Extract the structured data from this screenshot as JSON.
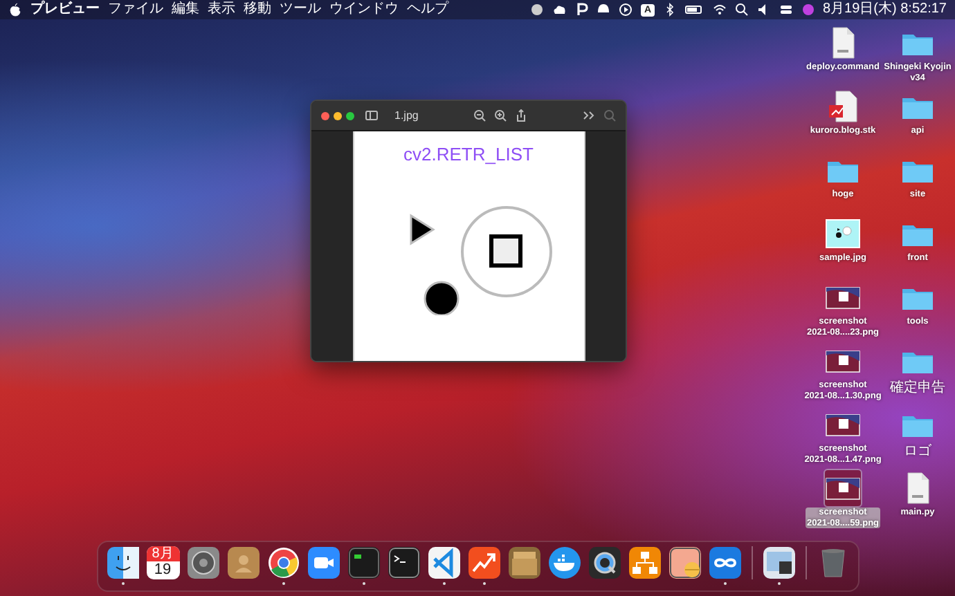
{
  "menu_bar": {
    "app_name": "プレビュー",
    "menus": [
      "ファイル",
      "編集",
      "表示",
      "移動",
      "ツール",
      "ウインドウ",
      "ヘルプ"
    ],
    "input_source": "A",
    "clock": "8月19日(木) 8:52:17"
  },
  "window": {
    "title": "1.jpg",
    "image": {
      "caption": "cv2.RETR_LIST"
    }
  },
  "desktop_icons": [
    {
      "kind": "script",
      "label_lines": [
        "deploy.command"
      ],
      "selected": false
    },
    {
      "kind": "stickies",
      "label_lines": [
        "kuroro.blog.stk"
      ],
      "selected": false
    },
    {
      "kind": "folder",
      "label_lines": [
        "hoge"
      ],
      "selected": false
    },
    {
      "kind": "image",
      "label_lines": [
        "sample.jpg"
      ],
      "selected": false
    },
    {
      "kind": "screenshot",
      "label_lines": [
        "screenshot",
        "2021-08....23.png"
      ],
      "selected": false
    },
    {
      "kind": "screenshot",
      "label_lines": [
        "screenshot",
        "2021-08...1.30.png"
      ],
      "selected": false
    },
    {
      "kind": "screenshot",
      "label_lines": [
        "screenshot",
        "2021-08...1.47.png"
      ],
      "selected": false
    },
    {
      "kind": "screenshot",
      "label_lines": [
        "screenshot",
        "2021-08....59.png"
      ],
      "selected": true
    },
    {
      "kind": "folder",
      "label_lines": [
        "Shingeki Kyojin",
        "v34"
      ],
      "selected": false
    },
    {
      "kind": "folder",
      "label_lines": [
        "api"
      ],
      "selected": false
    },
    {
      "kind": "folder",
      "label_lines": [
        "site"
      ],
      "selected": false
    },
    {
      "kind": "folder",
      "label_lines": [
        "front"
      ],
      "selected": false
    },
    {
      "kind": "folder",
      "label_lines": [
        "tools"
      ],
      "selected": false
    },
    {
      "kind": "folder",
      "label_lines": [
        "確定申告"
      ],
      "selected": false
    },
    {
      "kind": "folder",
      "label_lines": [
        "ロゴ"
      ],
      "selected": false
    },
    {
      "kind": "python",
      "label_lines": [
        "main.py"
      ],
      "selected": false
    }
  ],
  "dock": [
    {
      "kind": "finder",
      "running": true
    },
    {
      "kind": "calendar",
      "month": "8月",
      "day": "19",
      "running": false
    },
    {
      "kind": "settings",
      "running": false
    },
    {
      "kind": "contacts",
      "running": false
    },
    {
      "kind": "chrome",
      "running": true
    },
    {
      "kind": "zoom",
      "running": false
    },
    {
      "kind": "console",
      "running": true
    },
    {
      "kind": "terminal",
      "running": false
    },
    {
      "kind": "vscode",
      "running": true
    },
    {
      "kind": "graph",
      "running": true
    },
    {
      "kind": "archive",
      "running": false
    },
    {
      "kind": "docker",
      "running": false
    },
    {
      "kind": "quicktime",
      "running": false
    },
    {
      "kind": "diagram",
      "running": false
    },
    {
      "kind": "notes",
      "running": false
    },
    {
      "kind": "infinity",
      "running": true
    },
    {
      "kind": "divider"
    },
    {
      "kind": "preview",
      "running": true
    },
    {
      "kind": "divider"
    },
    {
      "kind": "trash",
      "running": false
    }
  ]
}
